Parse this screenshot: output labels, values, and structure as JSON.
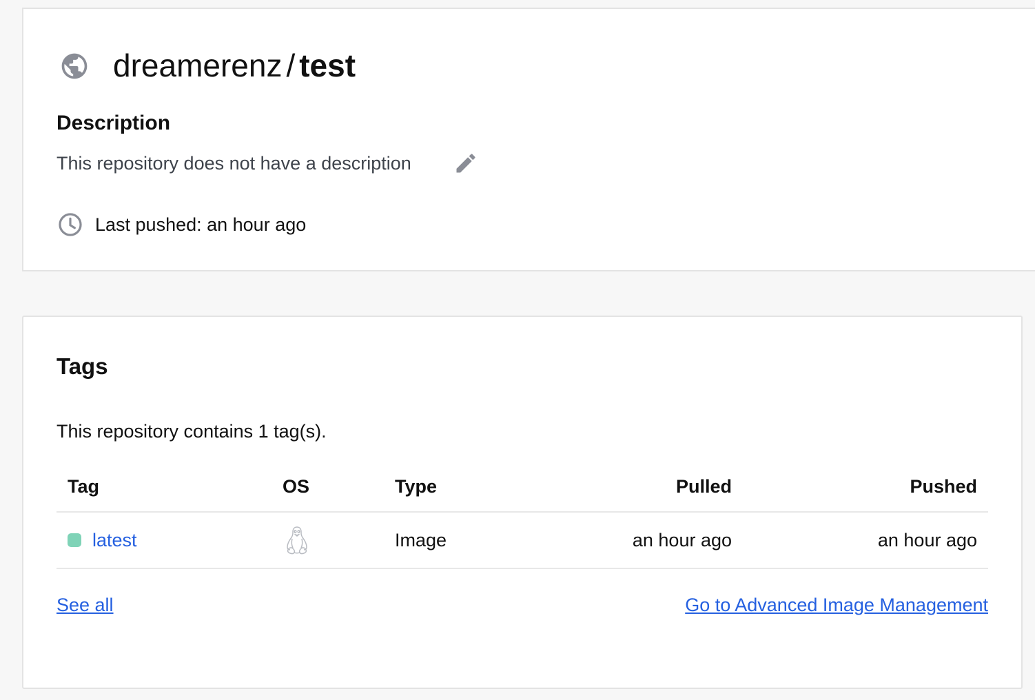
{
  "repository": {
    "namespace": "dreamerenz",
    "separator": "/",
    "name": "test",
    "description_heading": "Description",
    "description_text": "This repository does not have a description",
    "last_pushed": "Last pushed: an hour ago",
    "icons": {
      "visibility": "globe-icon",
      "edit": "pencil-icon",
      "time": "clock-icon"
    }
  },
  "tags": {
    "heading": "Tags",
    "summary": "This repository contains 1 tag(s).",
    "columns": {
      "tag": "Tag",
      "os": "OS",
      "type": "Type",
      "pulled": "Pulled",
      "pushed": "Pushed"
    },
    "rows": [
      {
        "tag": "latest",
        "os_icon": "linux-icon",
        "type": "Image",
        "pulled": "an hour ago",
        "pushed": "an hour ago",
        "status_color": "#7fd3b7"
      }
    ],
    "see_all": "See all",
    "advanced_link": "Go to Advanced Image Management"
  },
  "colors": {
    "link": "#2560e0",
    "icon_gray": "#8a8d96",
    "background": "#f7f7f7"
  }
}
